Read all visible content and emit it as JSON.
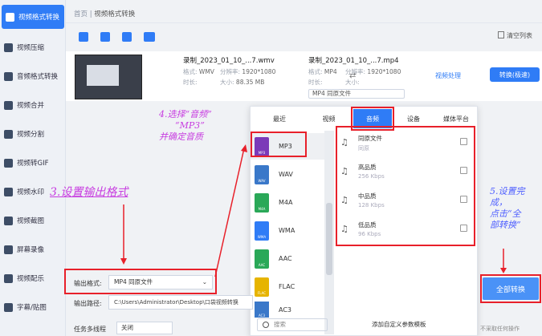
{
  "sidebar": {
    "items": [
      {
        "label": "视频格式转换",
        "active": true
      },
      {
        "label": "视频压缩"
      },
      {
        "label": "音频格式转换"
      },
      {
        "label": "视频合并"
      },
      {
        "label": "视频分割"
      },
      {
        "label": "视频转GIF"
      },
      {
        "label": "视频水印"
      },
      {
        "label": "视频截图"
      },
      {
        "label": "屏幕录像"
      },
      {
        "label": "视频配乐"
      },
      {
        "label": "字幕/贴图"
      }
    ]
  },
  "breadcrumb": {
    "home": "首页",
    "sep": " | ",
    "current": "视频格式转换"
  },
  "toolbar": {
    "clear_label": "清空列表",
    "icons": [
      "add-file-icon",
      "add-files-icon",
      "add-folder-icon",
      "import-icon"
    ]
  },
  "file": {
    "src_name": "录制_2023_01_10_...7.wmv",
    "src_format_label": "格式:",
    "src_format": "WMV",
    "src_res_label": "分辨率:",
    "src_res": "1920*1080",
    "src_dur_label": "时长:",
    "src_dur": "",
    "src_size_label": "大小:",
    "src_size": "88.35 MB",
    "dst_name": "录制_2023_01_10_...7.mp4",
    "dst_format_label": "格式:",
    "dst_format": "MP4",
    "dst_res_label": "分辨率:",
    "dst_res": "1920*1080",
    "dst_dur_label": "时长:",
    "dst_dur": "",
    "dst_size_label": "大小:",
    "dst_size": "",
    "target_format": "MP4  同原文件",
    "video_process_label": "视频处理",
    "convert_label": "转换(极速)"
  },
  "popup": {
    "tabs": [
      {
        "label": "最近"
      },
      {
        "label": "视频"
      },
      {
        "label": "音频",
        "active": true
      },
      {
        "label": "设备"
      },
      {
        "label": "媒体平台"
      }
    ],
    "formats": [
      {
        "label": "MP3",
        "tag": "MP3",
        "color": "#7b3ab8",
        "selected": true
      },
      {
        "label": "WAV",
        "tag": "WAV",
        "color": "#3a78c9"
      },
      {
        "label": "M4A",
        "tag": "M4A",
        "color": "#2aa858"
      },
      {
        "label": "WMA",
        "tag": "WMA",
        "color": "#2f7cf6"
      },
      {
        "label": "AAC",
        "tag": "AAC",
        "color": "#2aa858"
      },
      {
        "label": "FLAC",
        "tag": "FLAC",
        "color": "#e6b400"
      },
      {
        "label": "AC3",
        "tag": "AC3",
        "color": "#3a78c9"
      }
    ],
    "qualities": [
      {
        "name": "同原文件",
        "sub": "同原"
      },
      {
        "name": "高品质",
        "sub": "256 Kbps"
      },
      {
        "name": "中品质",
        "sub": "128 Kbps"
      },
      {
        "name": "低品质",
        "sub": "96 Kbps"
      }
    ],
    "search_placeholder": "搜索",
    "add_template_label": "添加自定义参数模板"
  },
  "bottom": {
    "output_format_label": "输出格式:",
    "output_format_value": "MP4  同原文件",
    "output_path_label": "输出路径:",
    "output_path_value": "C:\\Users\\Administrator\\Desktop\\口袋视频转换",
    "multi_label": "任务多线程",
    "multi_value": "关闭",
    "all_convert_label": "全部转换",
    "no_op_label": "不采取任何操作"
  },
  "annotations": {
    "step4_line1": "4.选择“音频”",
    "step4_line2": "“MP3”",
    "step4_line3": "并确定音质",
    "step3": "3.设置输出格式",
    "step5_line1": "5.设置完",
    "step5_line2": "成，",
    "step5_line3": "点击“全",
    "step5_line4": "部转换”"
  },
  "colors": {
    "accent": "#2f7cf6",
    "highlight": "#e8202a",
    "annotation_purple": "#c73ce0",
    "annotation_blue": "#5060ff"
  }
}
